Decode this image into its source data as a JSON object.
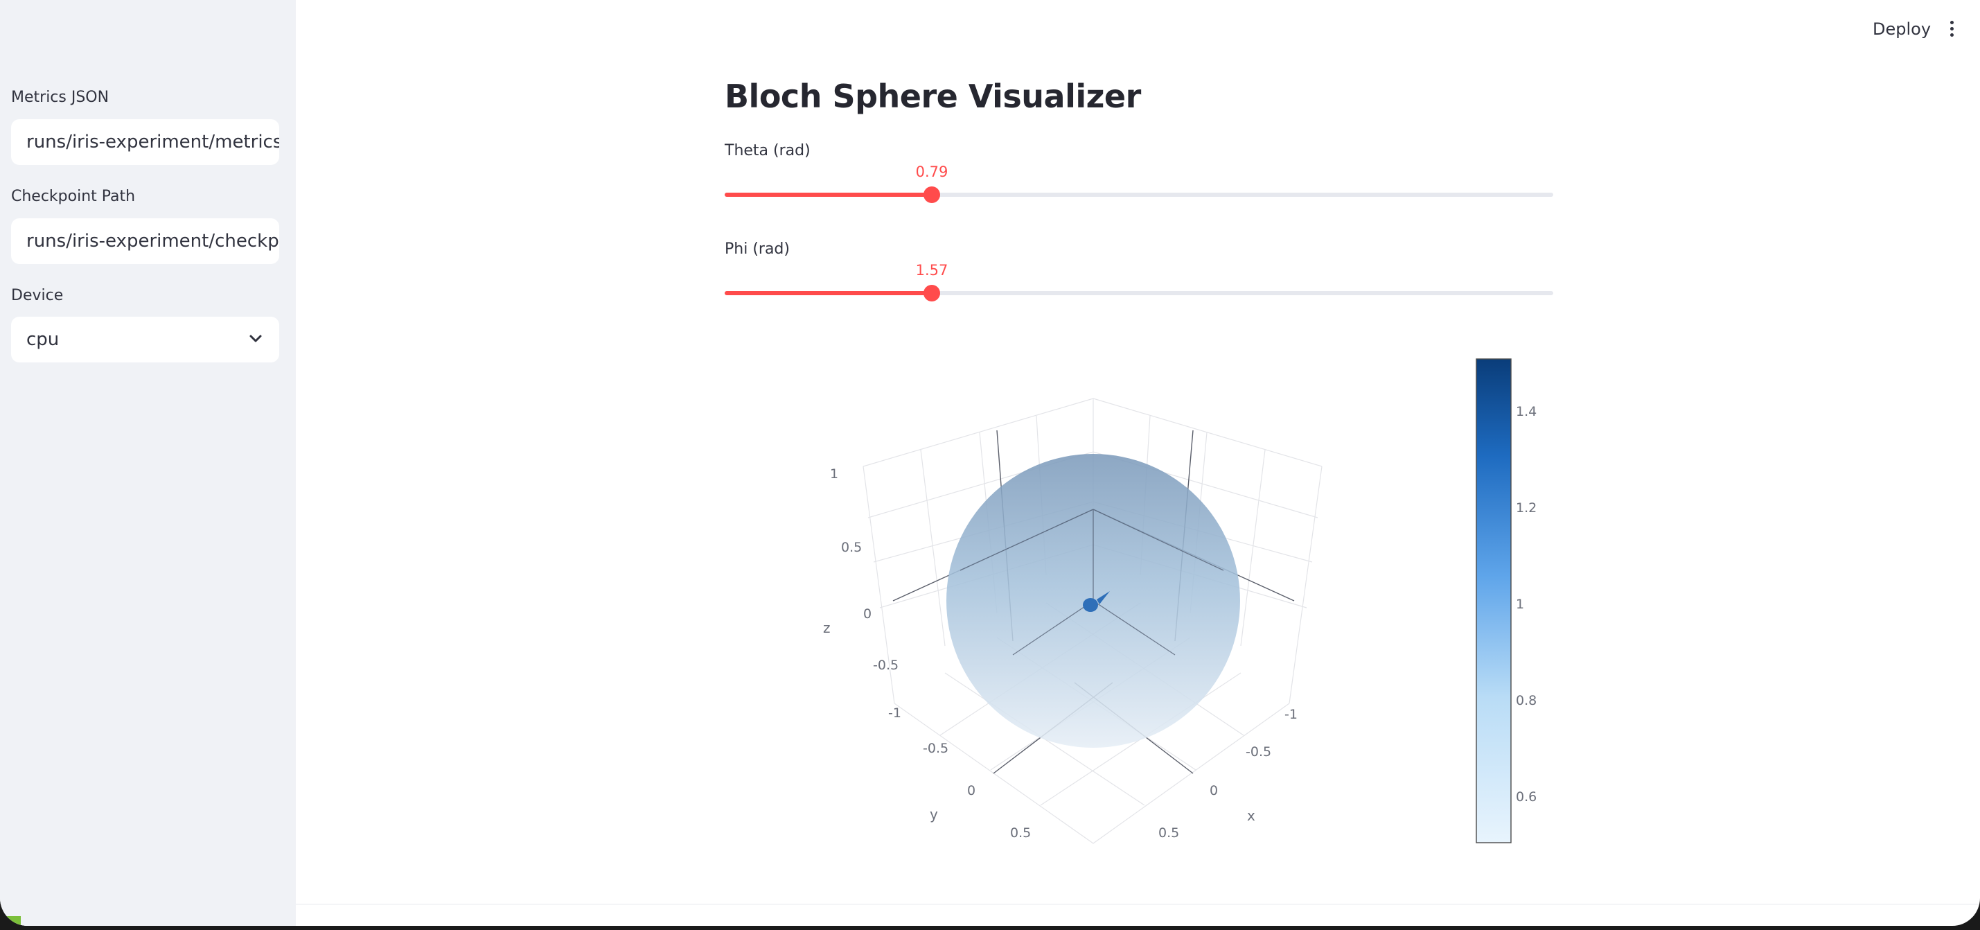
{
  "sidebar": {
    "metrics_json": {
      "label": "Metrics JSON",
      "value": "runs/iris-experiment/metrics.json"
    },
    "checkpoint_path": {
      "label": "Checkpoint Path",
      "value": "runs/iris-experiment/checkpoint.pt"
    },
    "device": {
      "label": "Device",
      "value": "cpu",
      "icon": "chevron-down-icon"
    }
  },
  "header": {
    "deploy_label": "Deploy",
    "menu_icon": "vertical-dots-icon"
  },
  "main": {
    "title": "Bloch Sphere Visualizer",
    "theta": {
      "label": "Theta (rad)",
      "value": "0.79",
      "fraction": 0.25
    },
    "phi": {
      "label": "Phi (rad)",
      "value": "1.57",
      "fraction": 0.25
    }
  },
  "colors": {
    "accent": "#ff4b4b",
    "sidebar_bg": "#f0f2f6",
    "colorscale_low": "#e8f4fd",
    "colorscale_high": "#0a3d7a"
  },
  "chart_data": {
    "type": "surface",
    "description_title": "",
    "axes": {
      "x": {
        "label": "x",
        "ticks": [
          "-1",
          "-0.5",
          "0",
          "0.5"
        ]
      },
      "y": {
        "label": "y",
        "ticks": [
          "-1",
          "-0.5",
          "0",
          "0.5"
        ]
      },
      "z": {
        "label": "z",
        "ticks": [
          "-1",
          "-0.5",
          "0",
          "0.5",
          "1"
        ]
      }
    },
    "colorbar": {
      "ticks": [
        "0.6",
        "0.8",
        "1",
        "1.2",
        "1.4"
      ],
      "range": [
        0.5,
        1.5
      ]
    },
    "state_vector": {
      "theta": 0.79,
      "phi": 1.57
    }
  }
}
